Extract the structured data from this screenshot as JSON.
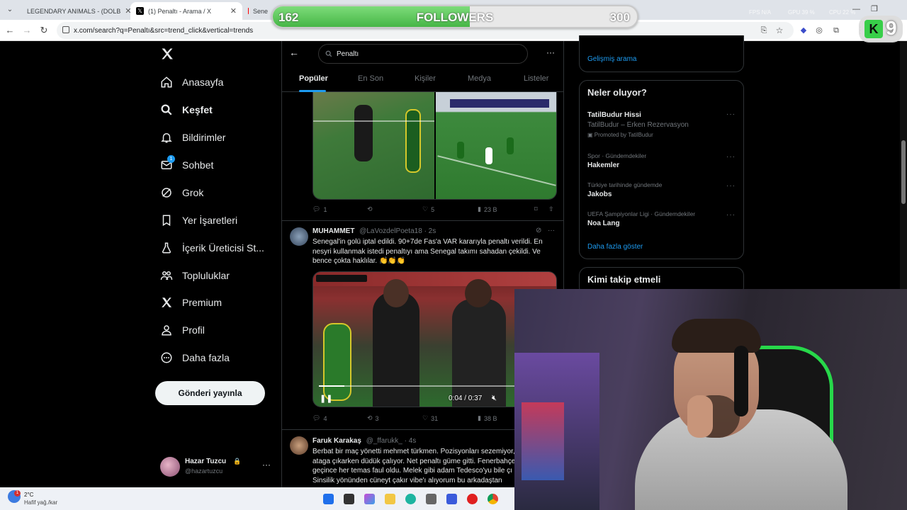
{
  "browser": {
    "tabs": [
      {
        "title": "LEGENDARY ANIMALS - (DOLB"
      },
      {
        "title": "(1) Penaltı - Arama / X"
      },
      {
        "title": "Sene"
      }
    ],
    "url": "x.com/search?q=Penaltı&src=trend_click&vertical=trends"
  },
  "overlay": {
    "followers_label": "FOLLOWERS",
    "current": "162",
    "goal": "300",
    "progress": 0.54,
    "fps_text": "FPS N/A",
    "gpu_text": "GPU 39 %",
    "cpu_text": "CPU 22 %",
    "badge_number": "9"
  },
  "sidebar": {
    "items": [
      {
        "label": "Anasayfa",
        "icon": "home-icon"
      },
      {
        "label": "Keşfet",
        "icon": "search-icon"
      },
      {
        "label": "Bildirimler",
        "icon": "bell-icon"
      },
      {
        "label": "Sohbet",
        "icon": "mail-icon",
        "badge": "1"
      },
      {
        "label": "Grok",
        "icon": "grok-icon"
      },
      {
        "label": "Yer İşaretleri",
        "icon": "bookmark-icon"
      },
      {
        "label": "İçerik Üreticisi St...",
        "icon": "flask-icon"
      },
      {
        "label": "Topluluklar",
        "icon": "people-icon"
      },
      {
        "label": "Premium",
        "icon": "x-logo-icon"
      },
      {
        "label": "Profil",
        "icon": "person-icon"
      },
      {
        "label": "Daha fazla",
        "icon": "more-circle-icon"
      }
    ],
    "post_button": "Gönderi yayınla",
    "account": {
      "name": "Hazar Tuzcu",
      "handle": "@hazartuzcu"
    }
  },
  "search": {
    "query": "Penaltı",
    "tabs": [
      "Popüler",
      "En Son",
      "Kişiler",
      "Medya",
      "Listeler"
    ]
  },
  "tweets": [
    {
      "stats": {
        "replies": "1",
        "reposts": "",
        "likes": "5",
        "views": "23 B"
      }
    },
    {
      "name": "MUHAMMET",
      "handle": "@LaVozdelPoeta18",
      "time": "· 2s",
      "text": "Senegal'in golü iptal edildi. 90+7de Fas'a VAR kararıyla penaltı verildi. En nesyri kullanmak istedi penaltıyı ama Senegal takımı sahadan çekildi. Ve bence çokta haklılar. 👏👏👏",
      "video_time": "0:04 / 0:37",
      "stats": {
        "replies": "4",
        "reposts": "3",
        "likes": "31",
        "views": "38 B"
      }
    },
    {
      "name": "Faruk Karakaş",
      "handle": "@_ffarukk_",
      "time": "· 4s",
      "text": "Berbat bir maç yönetti mehmet türkmen. Pozisyonları sezemiyor, ataga çıkarken düdük çalıyor. Net penaltı güme gitti. Fenerbahçe geçince her temas faul oldu. Melek gibi adam Tedesco'yu bile çı Sinsilik yönünden cüneyt çakır vibe'ı alıyorum bu arkadaştan"
    }
  ],
  "right": {
    "advanced_search": "Gelişmiş arama",
    "trends_title": "Neler oluyor?",
    "trends": [
      {
        "category": "",
        "name": "TatilBudur Hissi",
        "sub": "TatilBudur – Erken Rezervasyon",
        "promoted": "Promoted by TatilBudur"
      },
      {
        "category": "Spor · Gündemdekiler",
        "name": "Hakemler"
      },
      {
        "category": "Türkiye tarihinde gündemde",
        "name": "Jakobs"
      },
      {
        "category": "UEFA Şampiyonlar Ligi · Gündemdekiler",
        "name": "Noa Lang"
      }
    ],
    "show_more": "Daha fazla göster",
    "who_to_follow": "Kimi takip etmeli"
  },
  "taskbar": {
    "weather_temp": "2°C",
    "weather_desc": "Hafif yağ./kar"
  },
  "colors": {
    "accent": "#1d9bf0",
    "progress_green": "#46b646"
  }
}
